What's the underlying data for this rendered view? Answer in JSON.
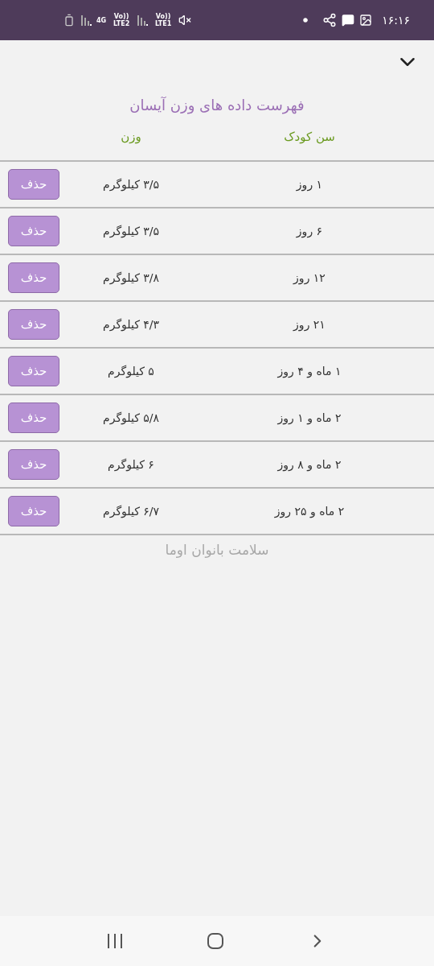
{
  "status_bar": {
    "time": "۱۶:۱۶",
    "network": "4G",
    "sim_2": "Vo)) LTE2",
    "sim_1": "Vo)) LTE1"
  },
  "title": "فهرست داده های وزن آیسان",
  "table": {
    "columns": [
      "سن کودک",
      "وزن"
    ],
    "rows": [
      {
        "age": "۱ روز",
        "weight": "۳/۵ کیلوگرم",
        "action": "حذف"
      },
      {
        "age": "۶ روز",
        "weight": "۳/۵ کیلوگرم",
        "action": "حذف"
      },
      {
        "age": "۱۲ روز",
        "weight": "۳/۸ کیلوگرم",
        "action": "حذف"
      },
      {
        "age": "۲۱ روز",
        "weight": "۴/۳ کیلوگرم",
        "action": "حذف"
      },
      {
        "age": "۱ ماه و ۴ روز",
        "weight": "۵ کیلوگرم",
        "action": "حذف"
      },
      {
        "age": "۲ ماه و ۱ روز",
        "weight": "۵/۸ کیلوگرم",
        "action": "حذف"
      },
      {
        "age": "۲ ماه و ۸ روز",
        "weight": "۶ کیلوگرم",
        "action": "حذف"
      },
      {
        "age": "۲ ماه و ۲۵ روز",
        "weight": "۶/۷ کیلوگرم",
        "action": "حذف"
      }
    ]
  },
  "background_caption": "سلامت بانوان اوما"
}
